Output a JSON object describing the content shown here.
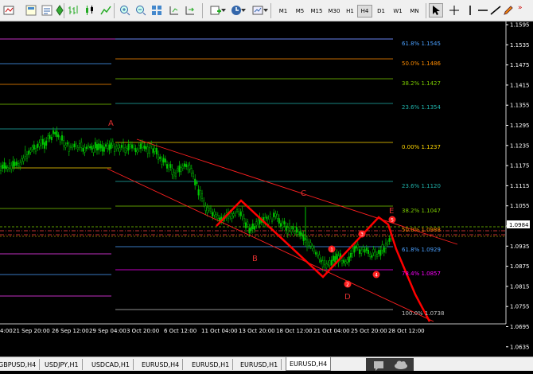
{
  "toolbar": {
    "timeframes": [
      "M1",
      "M5",
      "M15",
      "M30",
      "H1",
      "H4",
      "D1",
      "W1",
      "MN"
    ],
    "active_timeframe": "H4"
  },
  "chart": {
    "price_axis": [
      "1.1595",
      "1.1535",
      "1.1475",
      "1.1415",
      "1.1355",
      "1.1295",
      "1.1235",
      "1.1175",
      "1.1115",
      "1.1055",
      "1.0995",
      "1.0935",
      "1.0875",
      "1.0815",
      "1.0755",
      "1.0695",
      "1.0635"
    ],
    "current_price": "1.0984",
    "time_axis": [
      "21 Sep 20:00",
      "26 Sep 12:00",
      "29 Sep 04:00",
      "3 Oct 20:00",
      "6 Oct 12:00",
      "11 Oct 04:00",
      "13 Oct 20:00",
      "18 Oct 12:00",
      "21 Oct 04:00",
      "25 Oct 20:00",
      "28 Oct 12:00"
    ],
    "time_axis_partial": "4:00",
    "fib_upper": [
      {
        "text": "61.8%  1.1545",
        "color": "#4aa0ff"
      },
      {
        "text": "50.0%  1.1486",
        "color": "#ff8c00"
      },
      {
        "text": "38.2%  1.1427",
        "color": "#7ccd00"
      },
      {
        "text": "23.6%  1.1354",
        "color": "#20b2aa"
      },
      {
        "text": "0.00%  1.1237",
        "color": "#ffd700"
      }
    ],
    "fib_lower": [
      {
        "text": "23.6%  1.1120",
        "color": "#20b2aa"
      },
      {
        "text": "38.2%  1.1047",
        "color": "#7ccd00"
      },
      {
        "text": "50.0%  1.0988",
        "color": "#ff8c00"
      },
      {
        "text": "61.8%  1.0929",
        "color": "#4aa0ff"
      },
      {
        "text": "78.4%  1.0857",
        "color": "#ff00ff"
      },
      {
        "text": "100.0%  1.0738",
        "color": "#c0c0c0"
      }
    ],
    "wave_labels": [
      "A",
      "B",
      "C",
      "D",
      "E"
    ],
    "wave_numbers": [
      "1",
      "2",
      "3",
      "4",
      "5"
    ],
    "colors": {
      "background": "#000000",
      "candles": "#00c800",
      "pattern": "#ff0000",
      "axis_text": "#ffffff"
    }
  },
  "tabs": [
    "GBPUSD,H4",
    "USDJPY,H1",
    "USDCAD,H1",
    "EURUSD,H4",
    "EURUSD,H1",
    "EURUSD,H1",
    "EURUSD,H4"
  ],
  "active_tab": "EURUSD,H4"
}
